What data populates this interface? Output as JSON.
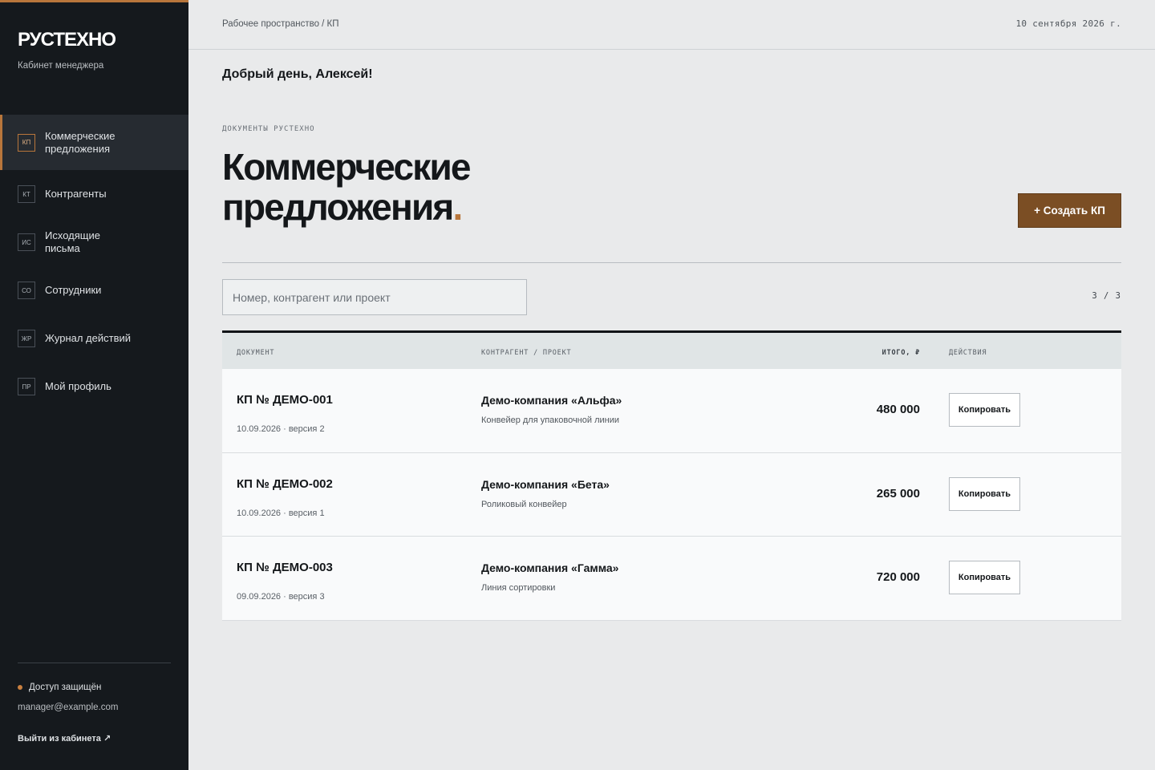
{
  "sidebar": {
    "brand": "РУСТЕХНО",
    "subtitle": "Кабинет менеджера",
    "items": [
      {
        "code": "КП",
        "label": "Коммерческие предложения"
      },
      {
        "code": "КТ",
        "label": "Контрагенты"
      },
      {
        "code": "ИС",
        "label": "Исходящие письма"
      },
      {
        "code": "СО",
        "label": "Сотрудники"
      },
      {
        "code": "ЖР",
        "label": "Журнал действий"
      },
      {
        "code": "ПР",
        "label": "Мой профиль"
      }
    ],
    "status": "Доступ защищён",
    "email": "manager@example.com",
    "logout": "Выйти из кабинета ↗"
  },
  "header": {
    "breadcrumb": "Рабочее пространство / КП",
    "date": "10 сентября 2026 г."
  },
  "main": {
    "greeting": "Добрый день, Алексей!",
    "eyebrow": "ДОКУМЕНТЫ РУСТЕХНО",
    "title": "Коммерческие предложения",
    "title_accent": ".",
    "create_label": "+ Создать КП",
    "search_placeholder": "Номер, контрагент или проект",
    "counter": "3 / 3"
  },
  "table": {
    "columns": [
      "ДОКУМЕНТ",
      "КОНТРАГЕНТ / ПРОЕКТ",
      "ИТОГО, ₽",
      "ДЕЙСТВИЯ"
    ],
    "rows": [
      {
        "number": "КП № ДЕМО-001",
        "meta": "10.09.2026 · версия 2",
        "company": "Демо-компания «Альфа»",
        "project": "Конвейер для упаковочной линии",
        "total": "480 000",
        "action": "Копировать"
      },
      {
        "number": "КП № ДЕМО-002",
        "meta": "10.09.2026 · версия 1",
        "company": "Демо-компания «Бета»",
        "project": "Роликовый конвейер",
        "total": "265 000",
        "action": "Копировать"
      },
      {
        "number": "КП № ДЕМО-003",
        "meta": "09.09.2026 · версия 3",
        "company": "Демо-компания «Гамма»",
        "project": "Линия сортировки",
        "total": "720 000",
        "action": "Копировать"
      }
    ]
  },
  "colors": {
    "accent": "#b8763b",
    "button": "#7b4e24",
    "sidebar": "#15191d"
  }
}
